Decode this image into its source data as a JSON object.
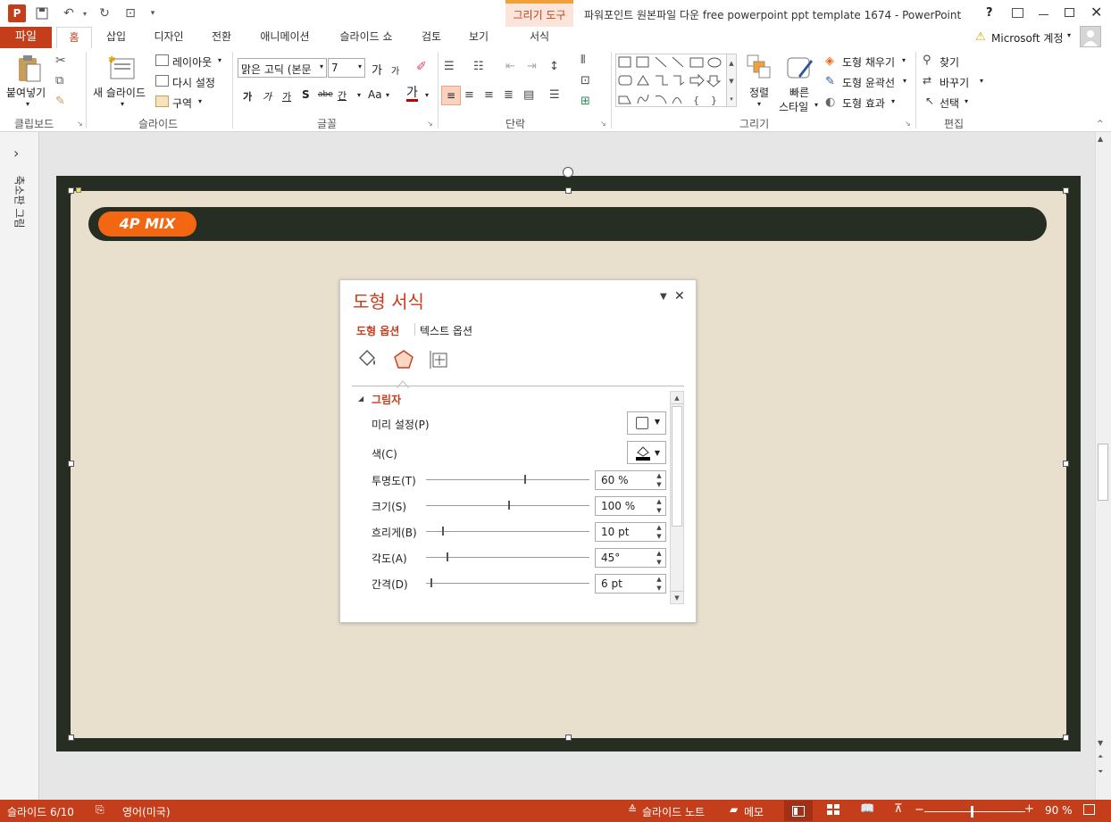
{
  "window": {
    "title": "파워포인트 원본파일 다운 free powerpoint ppt template 1674 - PowerPoint",
    "help": "?"
  },
  "context_tab": {
    "label": "그리기 도구"
  },
  "tabs": {
    "file": "파일",
    "home": "홈",
    "insert": "삽입",
    "design": "디자인",
    "transitions": "전환",
    "animations": "애니메이션",
    "slideshow": "슬라이드 쇼",
    "review": "검토",
    "view": "보기",
    "format": "서식"
  },
  "account": {
    "label": "Microsoft 계정"
  },
  "ribbon": {
    "clipboard": {
      "paste": "붙여넣기",
      "group": "클립보드"
    },
    "slides": {
      "new_slide": "새 슬라이드",
      "layout": "레이아웃",
      "reset": "다시 설정",
      "section": "구역",
      "group": "슬라이드"
    },
    "font": {
      "name": "맑은 고딕 (본문",
      "size": "7",
      "group": "글꼴",
      "bold": "가",
      "italic": "가",
      "underline": "가",
      "shadow": "S",
      "strike": "abe",
      "spacing": "간",
      "case": "Aa",
      "color": "가",
      "grow": "가",
      "shrink": "가"
    },
    "paragraph": {
      "group": "단락"
    },
    "drawing": {
      "arrange": "정렬",
      "quick_styles_1": "빠른",
      "quick_styles_2": "스타일",
      "fill": "도형 채우기",
      "outline": "도형 윤곽선",
      "effects": "도형 효과",
      "group": "그리기"
    },
    "editing": {
      "find": "찾기",
      "replace": "바꾸기",
      "select": "선택",
      "group": "편집"
    }
  },
  "left_pane": {
    "label": "축소판 그림",
    "chevron": "›"
  },
  "slide": {
    "badge": "4P MIX"
  },
  "format_pane": {
    "title": "도형 서식",
    "tab_shape": "도형 옵션",
    "tab_text": "텍스트 옵션",
    "section": "그림자",
    "rows": [
      {
        "label": "미리 설정(P)"
      },
      {
        "label": "색(C)"
      },
      {
        "label": "투명도(T)",
        "value": "60 %",
        "level": 0.6
      },
      {
        "label": "크기(S)",
        "value": "100 %",
        "level": 0.5
      },
      {
        "label": "흐리게(B)",
        "value": "10 pt",
        "level": 0.1
      },
      {
        "label": "각도(A)",
        "value": "45°",
        "level": 0.125
      },
      {
        "label": "간격(D)",
        "value": "6 pt",
        "level": 0.03
      }
    ]
  },
  "status": {
    "slide": "슬라이드 6/10",
    "language": "영어(미국)",
    "notes": "슬라이드 노트",
    "comments": "메모",
    "zoom": "90 %"
  },
  "colors": {
    "accent": "#c43e1c",
    "slide_dark": "#262e24",
    "slide_bg": "#e8dfcc",
    "badge": "#f36712"
  }
}
